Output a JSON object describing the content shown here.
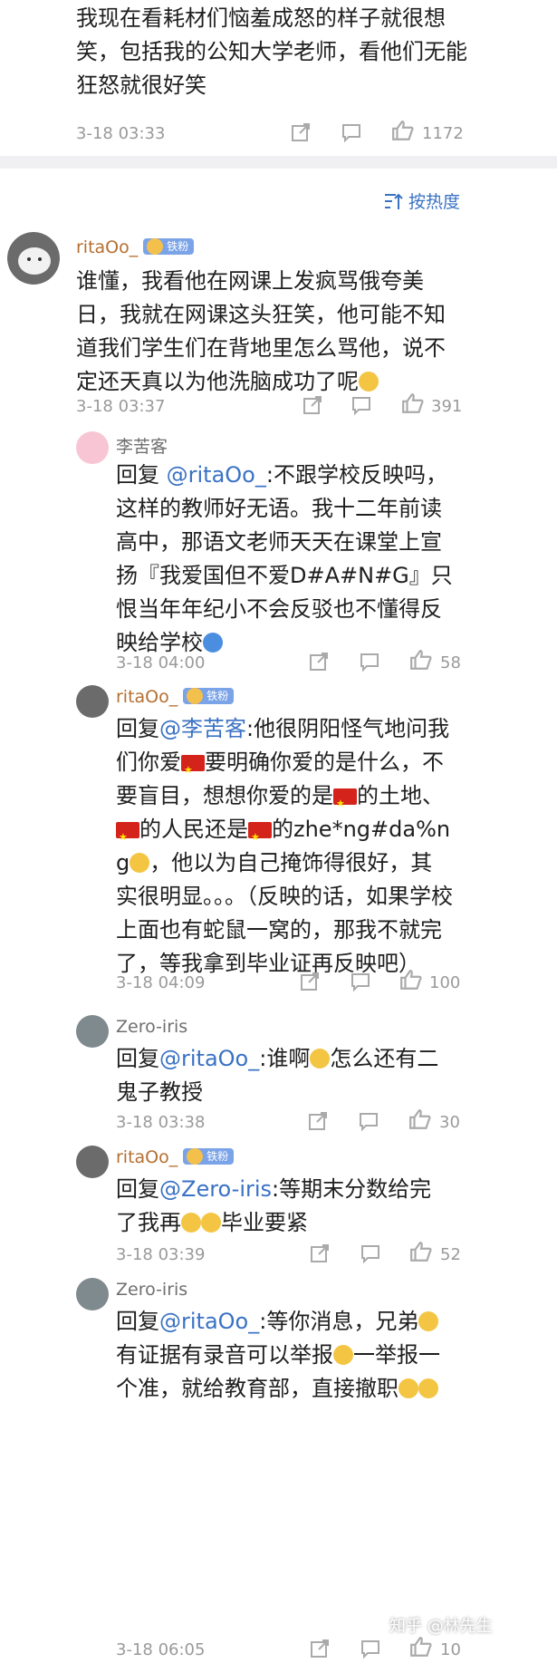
{
  "top_comment": {
    "text": "我现在看耗材们恼羞成怒的样子就很想笑，包括我的公知大学老师，看他们无能狂怒就很好笑",
    "time": "3-18 03:33",
    "likes": "1172"
  },
  "sort": {
    "label": "按热度"
  },
  "main_comment": {
    "user": "ritaOo_",
    "badge": "铁粉",
    "text": "谁懂，我看他在网课上发疯骂俄夸美日，我就在网课这头狂笑，他可能不知道我们学生们在背地里怎么骂他，说不定还天真以为他洗脑成功了呢",
    "time": "3-18 03:37",
    "likes": "391"
  },
  "replies": [
    {
      "user": "李苦客",
      "reply_prefix": "回复 ",
      "mention": "@ritaOo_",
      "text": ":不跟学校反映吗，这样的教师好无语。我十二年前读高中，那语文老师天天在课堂上宣扬『我爱国但不爱D#A#N#G』只恨当年年纪小不会反驳也不懂得反映给学校",
      "time": "3-18 04:00",
      "likes": "58"
    },
    {
      "user": "ritaOo_",
      "badge": "铁粉",
      "reply_prefix": "回复",
      "mention": "@李苦客",
      "text_a": ":他很阴阳怪气地问我们你爱",
      "text_b": "要明确你爱的是什么，不要盲目，想想你爱的是",
      "text_c": "的土地、",
      "text_d": "的人民还是",
      "text_e": "的zhe*ng#da%ng",
      "text_f": "，他以为自己掩饰得很好，其实很明显。。。（反映的话，如果学校上面也有蛇鼠一窝的，那我不就完了，等我拿到毕业证再反映吧）",
      "time": "3-18 04:09",
      "likes": "100"
    },
    {
      "user": "Zero-iris",
      "reply_prefix": "回复",
      "mention": "@ritaOo_",
      "text_a": ":谁啊",
      "text_b": "怎么还有二鬼子教授",
      "time": "3-18 03:38",
      "likes": "30"
    },
    {
      "user": "ritaOo_",
      "badge": "铁粉",
      "reply_prefix": "回复",
      "mention": "@Zero-iris",
      "text_a": ":等期末分数给完了我再",
      "text_b": "毕业要紧",
      "time": "3-18 03:39",
      "likes": "52"
    },
    {
      "user": "Zero-iris",
      "reply_prefix": "回复",
      "mention": "@ritaOo_",
      "text_a": ":等你消息，兄弟",
      "text_b": "有证据有录音可以举报",
      "text_c": "一举报一个准，就给教育部，直接撤职",
      "time": "3-18 06:05",
      "likes": "10"
    }
  ],
  "watermark": "知乎 @林先生",
  "colors": {
    "accent": "#3a72c4",
    "username": "#b46f30",
    "meta": "#9a9a9a",
    "separator": "#f0f0f2"
  },
  "icons": [
    "share-icon",
    "comment-icon",
    "like-icon",
    "sort-icon"
  ]
}
